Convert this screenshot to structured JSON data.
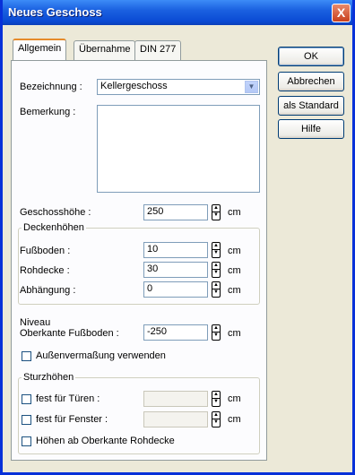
{
  "window": {
    "title": "Neues Geschoss",
    "close_glyph": "X"
  },
  "tabs": [
    "Allgemein",
    "Übernahme",
    "DIN 277"
  ],
  "buttons": {
    "ok": "OK",
    "cancel": "Abbrechen",
    "default": "als Standard",
    "help": "Hilfe"
  },
  "bezeichnung": {
    "label": "Bezeichnung :",
    "value": "Kellergeschoss"
  },
  "bemerkung": {
    "label": "Bemerkung :",
    "value": ""
  },
  "geschosshoehe": {
    "label": "Geschosshöhe :",
    "value": "250",
    "unit": "cm"
  },
  "deckenhoehen": {
    "caption": "Deckenhöhen",
    "rows": [
      {
        "label": "Fußboden :",
        "value": "10",
        "unit": "cm"
      },
      {
        "label": "Rohdecke :",
        "value": "30",
        "unit": "cm"
      },
      {
        "label": "Abhängung :",
        "value": "0",
        "unit": "cm"
      }
    ]
  },
  "niveau": {
    "label_line1": "Niveau",
    "label_line2": "Oberkante Fußboden :",
    "value": "-250",
    "unit": "cm"
  },
  "aussenvermassung": {
    "label": "Außenvermaßung verwenden",
    "checked": false
  },
  "sturzhoehen": {
    "caption": "Sturzhöhen",
    "tueren": {
      "label": "fest für Türen :",
      "value": "",
      "unit": "cm",
      "checked": false
    },
    "fenster": {
      "label": "fest für Fenster :",
      "value": "",
      "unit": "cm",
      "checked": false
    },
    "rohdecke": {
      "label": "Höhen ab Oberkante Rohdecke",
      "checked": false
    }
  },
  "icons": {
    "spin_up": "▲",
    "spin_down": "▼",
    "dropdown": "▼"
  }
}
